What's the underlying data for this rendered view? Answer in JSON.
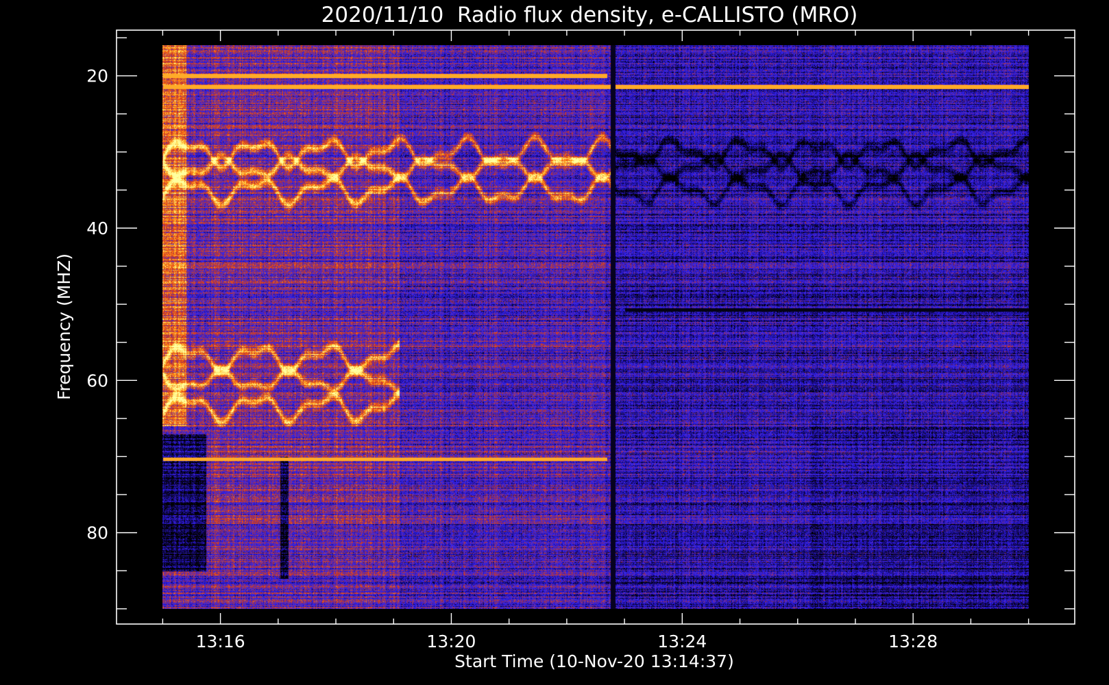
{
  "chart_data": {
    "type": "heatmap",
    "title": "2020/11/10  Radio flux density, e-CALLISTO (MRO)",
    "xlabel": "Start Time (10-Nov-20 13:14:37)",
    "ylabel": "Frequency (MHZ)",
    "x_ticks": [
      "13:16",
      "13:20",
      "13:24",
      "13:28"
    ],
    "x_tick_minutes": [
      16,
      20,
      24,
      28
    ],
    "y_ticks": [
      "20",
      "40",
      "60",
      "80"
    ],
    "y_tick_values": [
      20,
      40,
      60,
      80
    ],
    "xlim_minutes": [
      14.2,
      30.8
    ],
    "data_xlim_minutes": [
      15.0,
      30.0
    ],
    "ylim": [
      14,
      92
    ],
    "data_ylim": [
      16,
      90
    ],
    "y_inverted": true,
    "grid": false,
    "colormap": [
      "#000000",
      "#1a0a80",
      "#2a1ae0",
      "#3c2ae8",
      "#a0304a",
      "#e0401c",
      "#ff7a10",
      "#ffd23a",
      "#ffffa0"
    ],
    "features": [
      {
        "kind": "horizontal_line",
        "freq_mhz": 20.0,
        "t_start": 15.0,
        "t_end": 22.7,
        "color": "#ffb040"
      },
      {
        "kind": "horizontal_line",
        "freq_mhz": 21.4,
        "t_start": 15.0,
        "t_end": 30.0,
        "color": "#ff8020"
      },
      {
        "kind": "horizontal_line",
        "freq_mhz": 70.3,
        "t_start": 15.0,
        "t_end": 22.7,
        "color": "#ffb040"
      },
      {
        "kind": "horizontal_line",
        "freq_mhz": 50.7,
        "t_start": 23.0,
        "t_end": 30.0,
        "color": "#000000"
      },
      {
        "kind": "vertical_line",
        "time_min": 22.8,
        "color": "#000000"
      },
      {
        "kind": "wave_bands",
        "freq_mhz": [
          30,
          32,
          35
        ],
        "t_start": 15.0,
        "t_end": 30.0
      },
      {
        "kind": "wave_bands",
        "freq_mhz": [
          57,
          60,
          63.5
        ],
        "t_start": 15.0,
        "t_end": 19.1
      }
    ]
  }
}
